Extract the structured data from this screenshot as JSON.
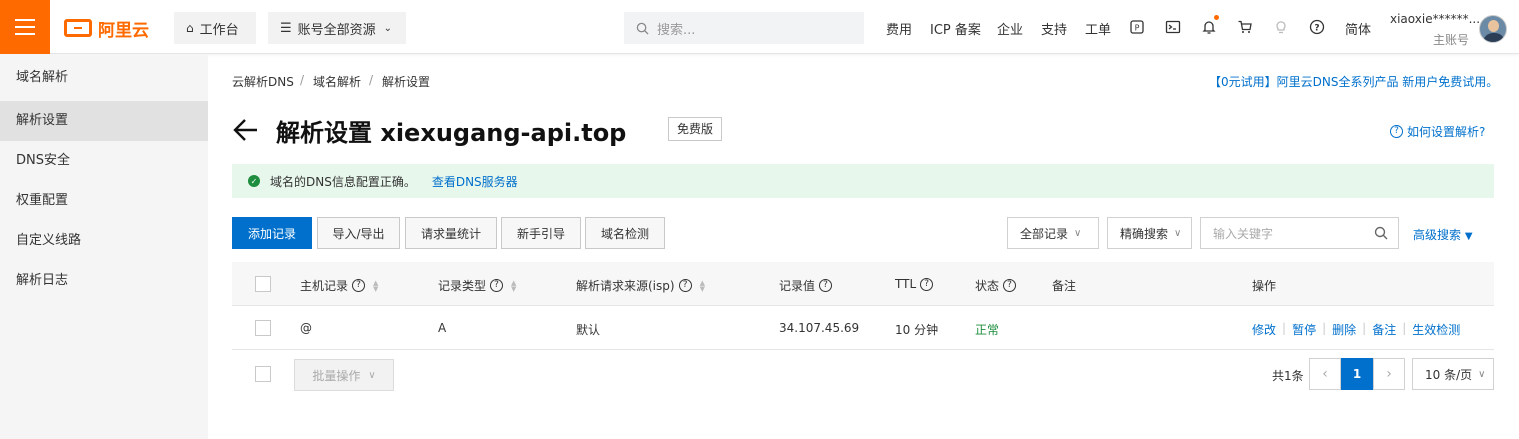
{
  "header": {
    "brand": "阿里云",
    "workbench": "工作台",
    "resources": "账号全部资源",
    "search_placeholder": "搜索...",
    "nav": [
      "费用",
      "ICP 备案",
      "企业",
      "支持",
      "工单"
    ],
    "lang": "简体",
    "user_name": "xiaoxie******...",
    "user_role": "主账号"
  },
  "sidebar": {
    "items": [
      {
        "label": "域名解析"
      },
      {
        "label": "解析设置"
      },
      {
        "label": "DNS安全"
      },
      {
        "label": "权重配置"
      },
      {
        "label": "自定义线路"
      },
      {
        "label": "解析日志"
      }
    ]
  },
  "breadcrumb": [
    "云解析DNS",
    "域名解析",
    "解析设置"
  ],
  "promo": "【0元试用】阿里云DNS全系列产品 新用户免费试用。",
  "title": "解析设置 xiexugang-api.top",
  "plan_badge": "免费版",
  "help_link": "如何设置解析?",
  "notice": {
    "text": "域名的DNS信息配置正确。",
    "link": "查看DNS服务器"
  },
  "toolbar": {
    "add": "添加记录",
    "import_export": "导入/导出",
    "stats": "请求量统计",
    "guide": "新手引导",
    "check": "域名检测",
    "filter_all": "全部记录",
    "exact_search": "精确搜索",
    "keyword_placeholder": "输入关键字",
    "advanced": "高级搜索"
  },
  "table": {
    "columns": [
      "主机记录",
      "记录类型",
      "解析请求来源(isp)",
      "记录值",
      "TTL",
      "状态",
      "备注",
      "操作"
    ],
    "rows": [
      {
        "host": "@",
        "type": "A",
        "line": "默认",
        "value": "34.107.45.69",
        "ttl": "10 分钟",
        "status": "正常",
        "remark": ""
      }
    ],
    "row_actions": [
      "修改",
      "暂停",
      "删除",
      "备注",
      "生效检测"
    ]
  },
  "footer": {
    "batch": "批量操作",
    "total": "共1条",
    "current_page": "1",
    "page_size": "10 条/页"
  },
  "colors": {
    "brand": "#ff6a00",
    "primary": "#0070cc",
    "success": "#1e8e3e"
  }
}
